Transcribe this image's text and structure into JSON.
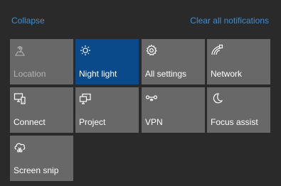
{
  "header": {
    "collapse_label": "Collapse",
    "clear_label": "Clear all notifications"
  },
  "tiles": [
    {
      "label": "Location",
      "icon": "location-icon",
      "state": "disabled"
    },
    {
      "label": "Night light",
      "icon": "night-light-icon",
      "state": "on"
    },
    {
      "label": "All settings",
      "icon": "gear-icon",
      "state": "off"
    },
    {
      "label": "Network",
      "icon": "network-icon",
      "state": "off"
    },
    {
      "label": "Connect",
      "icon": "connect-icon",
      "state": "off"
    },
    {
      "label": "Project",
      "icon": "project-icon",
      "state": "off"
    },
    {
      "label": "VPN",
      "icon": "vpn-icon",
      "state": "off"
    },
    {
      "label": "Focus assist",
      "icon": "moon-icon",
      "state": "off"
    },
    {
      "label": "Screen snip",
      "icon": "screen-snip-icon",
      "state": "off"
    }
  ],
  "colors": {
    "background": "#2a2a2a",
    "tile": "#686868",
    "tile_active": "#0a4a8a",
    "link_accent": "#3a8fd6",
    "text": "#ffffff",
    "text_disabled": "#b3b3b3"
  }
}
